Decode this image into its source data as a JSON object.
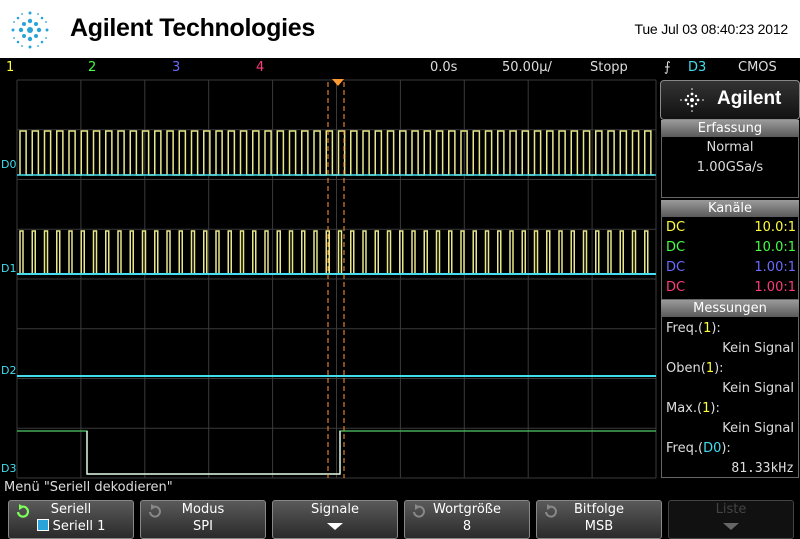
{
  "header": {
    "brand": "Agilent Technologies",
    "timestamp": "Tue Jul 03 08:40:23 2012"
  },
  "status_bar": {
    "channels": [
      "1",
      "2",
      "3",
      "4"
    ],
    "delay": "0.0s",
    "timebase": "50.00µ/",
    "run_state": "Stopp",
    "trigger_source": "D3",
    "logic_family": "CMOS"
  },
  "colors": {
    "ch1": "#ffff3a",
    "ch2": "#44ff44",
    "ch3": "#6a6aff",
    "ch4": "#ff3a7a",
    "digital": "#44ddee",
    "grid": "#444444",
    "cursor": "#ff9933"
  },
  "waveform": {
    "labels": [
      "D0",
      "D1",
      "D2",
      "D3"
    ]
  },
  "side_panel": {
    "brand": "Agilent",
    "acquisition": {
      "title": "Erfassung",
      "mode": "Normal",
      "rate": "1.00GSa/s"
    },
    "channels": {
      "title": "Kanäle",
      "rows": [
        {
          "coupling": "DC",
          "probe": "10.0:1",
          "color": "#ffff3a"
        },
        {
          "coupling": "DC",
          "probe": "10.0:1",
          "color": "#44ff44"
        },
        {
          "coupling": "DC",
          "probe": "1.00:1",
          "color": "#6a6aff"
        },
        {
          "coupling": "DC",
          "probe": "1.00:1",
          "color": "#ff3a7a"
        }
      ]
    },
    "measurements": {
      "title": "Messungen",
      "items": [
        {
          "name": "Freq.",
          "source": "1",
          "value": "Kein Signal"
        },
        {
          "name": "Oben",
          "source": "1",
          "value": "Kein Signal"
        },
        {
          "name": "Max.",
          "source": "1",
          "value": "Kein Signal"
        },
        {
          "name": "Freq.",
          "source": "D0",
          "value": "81.33kHz"
        }
      ]
    }
  },
  "menu": {
    "title": "Menü \"Seriell dekodieren\"",
    "softkeys": [
      {
        "label": "Seriell",
        "value": "Seriell 1"
      },
      {
        "label": "Modus",
        "value": "SPI"
      },
      {
        "label": "Signale",
        "value": ""
      },
      {
        "label": "Wortgröße",
        "value": "8"
      },
      {
        "label": "Bitfolge",
        "value": "MSB"
      },
      {
        "label": "Liste",
        "value": ""
      }
    ]
  }
}
